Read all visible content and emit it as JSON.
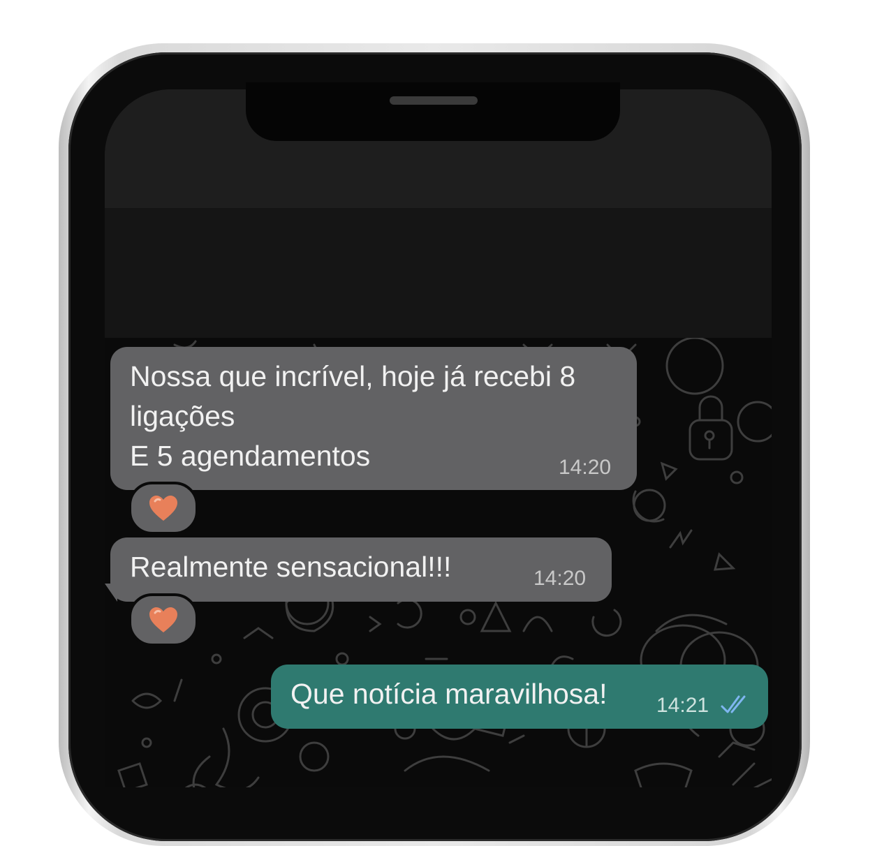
{
  "chat": {
    "messages": [
      {
        "direction": "incoming",
        "text": "Nossa que incrível, hoje já recebi 8\nligações\nE 5 agendamentos",
        "time": "14:20",
        "reaction": "heart-icon"
      },
      {
        "direction": "incoming",
        "text": "Realmente sensacional!!!",
        "time": "14:20",
        "reaction": "heart-icon"
      },
      {
        "direction": "outgoing",
        "text": "Que notícia maravilhosa!",
        "time": "14:21",
        "status": "read"
      }
    ]
  },
  "colors": {
    "incoming_bubble": "#626264",
    "outgoing_bubble": "#2f7a70",
    "read_ticks": "#7fb6f0",
    "reaction_heart": "#e8805a",
    "chat_background": "#0a0a0a"
  }
}
